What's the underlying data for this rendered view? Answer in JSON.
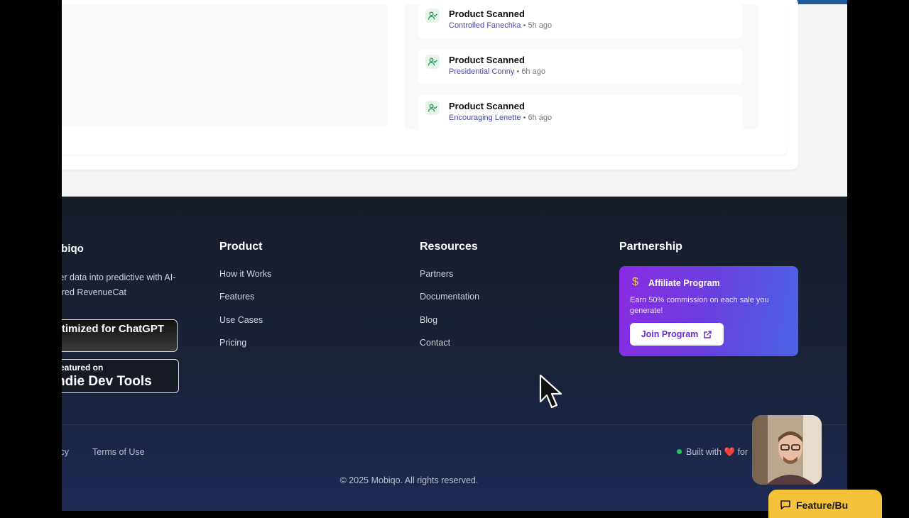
{
  "activity": {
    "items": [
      {
        "title": "Product Scanned",
        "name": "Controlled Fanechka",
        "time": "5h ago"
      },
      {
        "title": "Product Scanned",
        "name": "Presidential Conny",
        "time": "6h ago"
      },
      {
        "title": "Product Scanned",
        "name": "Encouraging Lenette",
        "time": "6h ago"
      }
    ]
  },
  "footer": {
    "brand": "obiqo",
    "tagline": "le user data into predictive with AI-powered RevenueCat",
    "badges": {
      "chatgpt": "Optimized for ChatGPT",
      "indie_small": "eatured on",
      "indie_big": "ndie Dev Tools"
    },
    "product": {
      "title": "Product",
      "links": [
        "How it Works",
        "Features",
        "Use Cases",
        "Pricing"
      ]
    },
    "resources": {
      "title": "Resources",
      "links": [
        "Partners",
        "Documentation",
        "Blog",
        "Contact"
      ]
    },
    "partnership": {
      "title": "Partnership",
      "affiliate_title": "Affiliate Program",
      "affiliate_desc": "Earn 50% commission on each sale you generate!",
      "affiliate_button": "Join Program"
    },
    "legal": {
      "privacy": "licy",
      "terms": "Terms of Use"
    },
    "built_with": {
      "prefix": "Built with",
      "suffix": "for"
    },
    "copyright": "© 2025 Mobiqo. All rights reserved."
  },
  "feedback_button": "Feature/Bu",
  "colors": {
    "accent_green": "#22c55e",
    "affiliate_gradient_start": "#8a2be2",
    "affiliate_gradient_end": "#4a63e6",
    "feedback_yellow": "#f6c23a",
    "link_purple": "#4a4aa8"
  }
}
